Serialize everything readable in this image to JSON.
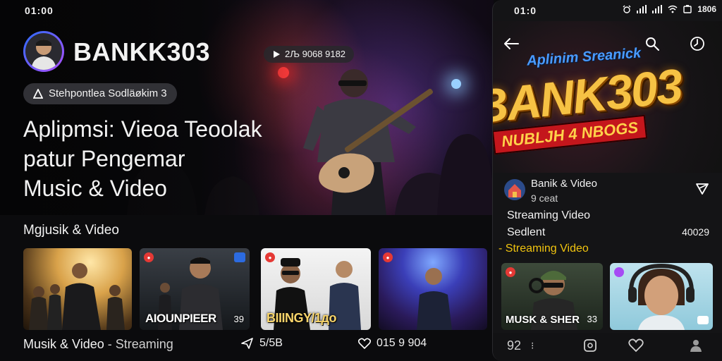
{
  "hero": {
    "status_time": "01:00",
    "brand_name": "BANKK303",
    "views": "2Љ 9068 9182",
    "tag": "Stehpontleа Sodläøkim 3",
    "headline_line1": "Aplipmsi: Viеoa Teoolak",
    "headline_line2": "patur Pengemar",
    "headline_line3": "Music & Video"
  },
  "section": {
    "title": "Mgjusik & Video"
  },
  "cards": [
    {
      "overlay_text": "",
      "count": ""
    },
    {
      "overlay_text": "AIOUNPIEER",
      "count": "39"
    },
    {
      "overlay_text": "BIIINGY/1дo",
      "count": ""
    },
    {
      "overlay_text": "",
      "count": ""
    }
  ],
  "footer": {
    "label_main": "Musik & Video",
    "label_sep": " - ",
    "label_sub": "Streaming",
    "share_count": "5/5B",
    "like_count": "015 9 904"
  },
  "phone": {
    "status_time": "01:0",
    "status_right": "1806",
    "logo_sub": "Aplinim Sreanick",
    "logo_main": "BANK303",
    "logo_ribbon": "NUBLJH 4 NBOGS",
    "channel_name": "Banik & Video",
    "channel_sub": "9 ceat",
    "line1": "Streaming Video",
    "line2": "Sedlent",
    "line3": "- Streaming Video",
    "count": "40029",
    "card1_overlay": "MUSK & SHER",
    "card1_count": "33",
    "tab1_label": "92"
  },
  "colors": {
    "accent_yellow": "#f1c40f",
    "logo_gold": "#f6c244",
    "logo_blue": "#4a9bff",
    "live_red": "#e53935"
  },
  "icons": {
    "back": "arrow-left-icon",
    "search": "search-icon",
    "clock": "clock-icon",
    "share": "share-icon",
    "heart": "heart-icon",
    "profile": "profile-icon",
    "home": "home-icon"
  }
}
